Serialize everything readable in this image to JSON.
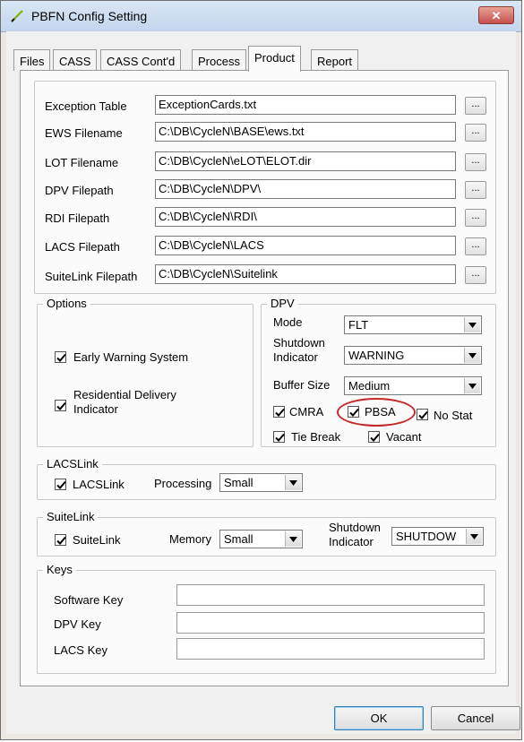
{
  "window": {
    "title": "PBFN Config Setting",
    "close_symbol": "✕"
  },
  "tabs": [
    {
      "label": "Files"
    },
    {
      "label": "CASS"
    },
    {
      "label": "CASS Cont'd"
    },
    {
      "label": "Process"
    },
    {
      "label": "Product"
    },
    {
      "label": "Report"
    }
  ],
  "active_tab": "Product",
  "files": [
    {
      "label": "Exception Table",
      "value": "ExceptionCards.txt",
      "browse": "..."
    },
    {
      "label": "EWS Filename",
      "value": "C:\\DB\\CycleN\\BASE\\ews.txt",
      "browse": "..."
    },
    {
      "label": "LOT Filename",
      "value": "C:\\DB\\CycleN\\eLOT\\ELOT.dir",
      "browse": "..."
    },
    {
      "label": "DPV Filepath",
      "value": "C:\\DB\\CycleN\\DPV\\",
      "browse": "..."
    },
    {
      "label": "RDI Filepath",
      "value": "C:\\DB\\CycleN\\RDI\\",
      "browse": "..."
    },
    {
      "label": "LACS Filepath",
      "value": "C:\\DB\\CycleN\\LACS",
      "browse": "..."
    },
    {
      "label": "SuiteLink Filepath",
      "value": "C:\\DB\\CycleN\\Suitelink",
      "browse": "..."
    }
  ],
  "options": {
    "title": "Options",
    "early_warning": {
      "label": "Early Warning System",
      "checked": true
    },
    "rdi": {
      "label_line1": "Residential Delivery",
      "label_line2": "Indicator",
      "checked": true
    }
  },
  "dpv": {
    "title": "DPV",
    "mode_label": "Mode",
    "mode_value": "FLT",
    "shutdown_label_line1": "Shutdown",
    "shutdown_label_line2": "Indicator",
    "shutdown_value": "WARNING",
    "buffer_label": "Buffer Size",
    "buffer_value": "Medium",
    "cmra": {
      "label": "CMRA",
      "checked": true
    },
    "pbsa": {
      "label": "PBSA",
      "checked": true
    },
    "nostat": {
      "label": "No Stat",
      "checked": true
    },
    "tiebreak": {
      "label": "Tie Break",
      "checked": true
    },
    "vacant": {
      "label": "Vacant",
      "checked": true
    }
  },
  "lacslink": {
    "title": "LACSLink",
    "checkbox_label": "LACSLink",
    "checked": true,
    "processing_label": "Processing",
    "processing_value": "Small"
  },
  "suitelink": {
    "title": "SuiteLink",
    "checkbox_label": "SuiteLink",
    "checked": true,
    "memory_label": "Memory",
    "memory_value": "Small",
    "shutdown_label_line1": "Shutdown",
    "shutdown_label_line2": "Indicator",
    "shutdown_value": "SHUTDOW"
  },
  "keys": {
    "title": "Keys",
    "software_label": "Software Key",
    "software_value": "",
    "dpv_label": "DPV Key",
    "dpv_value": "",
    "lacs_label": "LACS Key",
    "lacs_value": ""
  },
  "buttons": {
    "ok": "OK",
    "cancel": "Cancel"
  },
  "colors": {
    "annotation": "#c62828",
    "title_gradient_top": "#d9e6f5",
    "close": "#c75050"
  }
}
